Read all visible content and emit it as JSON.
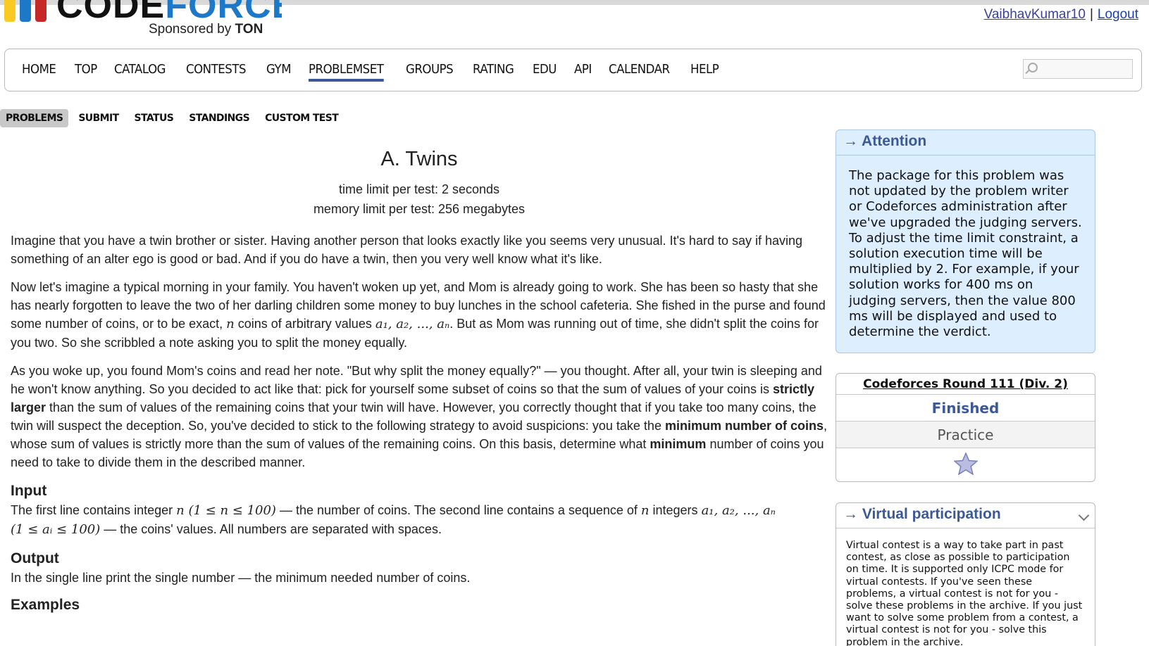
{
  "header": {
    "logo_word_dark": "CODE",
    "logo_word_blue": "FORCES",
    "sponsor_prefix": "Sponsored by",
    "sponsor_name": "TON",
    "user": "VaibhavKumar10",
    "separator": "|",
    "logout": "Logout"
  },
  "menu": {
    "items": [
      "HOME",
      "TOP",
      "CATALOG",
      "CONTESTS",
      "GYM",
      "PROBLEMSET",
      "GROUPS",
      "RATING",
      "EDU",
      "API",
      "CALENDAR",
      "HELP"
    ],
    "active": "PROBLEMSET"
  },
  "submenu": {
    "items": [
      "PROBLEMS",
      "SUBMIT",
      "STATUS",
      "STANDINGS",
      "CUSTOM TEST"
    ],
    "active": "PROBLEMS"
  },
  "problem": {
    "title": "A. Twins",
    "time_limit": "time limit per test: 2 seconds",
    "memory_limit": "memory limit per test: 256 megabytes",
    "p1": "Imagine that you have a twin brother or sister. Having another person that looks exactly like you seems very unusual. It's hard to say if having something of an alter ego is good or bad. And if you do have a twin, then you very well know what it's like.",
    "p2_a": "Now let's imagine a typical morning in your family. You haven't woken up yet, and Mom is already going to work. She has been so hasty that she has nearly forgotten to leave the two of her darling children some money to buy lunches in the school cafeteria. She fished in the purse and found some number of coins, or to be exact, ",
    "p2_n": "n",
    "p2_b": " coins of arbitrary values ",
    "p2_vals": "a₁, a₂, ..., aₙ",
    "p2_c": ". But as Mom was running out of time, she didn't split the coins for you two. So she scribbled a note asking you to split the money equally.",
    "p3_a": "As you woke up, you found Mom's coins and read her note. \"But why split the money equally?\" — you thought. After all, your twin is sleeping and he won't know anything. So you decided to act like that: pick for yourself some subset of coins so that the sum of values of your coins is ",
    "p3_b1": "strictly larger",
    "p3_b": " than the sum of values of the remaining coins that your twin will have. However, you correctly thought that if you take too many coins, the twin will suspect the deception. So, you've decided to stick to the following strategy to avoid suspicions: you take the ",
    "p3_b2": "minimum number of coins",
    "p3_c": ", whose sum of values is strictly more than the sum of values of the remaining coins. On this basis, determine what ",
    "p3_b3": "minimum",
    "p3_d": " number of coins you need to take to divide them in the described manner.",
    "input_title": "Input",
    "input_a": "The first line contains integer ",
    "input_n": "n",
    "input_range": " (1 ≤ n ≤ 100)",
    "input_b": " — the number of coins. The second line contains a sequence of ",
    "input_n2": "n",
    "input_c": " integers ",
    "input_vals": "a₁, a₂, ..., aₙ",
    "input_range2": "(1 ≤ aᵢ ≤ 100)",
    "input_d": " — the coins' values. All numbers are separated with spaces.",
    "output_title": "Output",
    "output_text": "In the single line print the single number — the minimum needed number of coins.",
    "examples_title": "Examples"
  },
  "sidebar": {
    "attention_title": "→ Attention",
    "attention_text": "The package for this problem was not updated by the problem writer or Codeforces administration after we've upgraded the judging servers. To adjust the time limit constraint, a solution execution time will be multiplied by 2. For example, if your solution works for 400 ms on judging servers, then the value 800 ms will be displayed and used to determine the verdict.",
    "round_name": "Codeforces Round 111 (Div. 2)",
    "round_status": "Finished",
    "round_mode": "Practice",
    "virtual_title": "→ Virtual participation",
    "virtual_text": "Virtual contest is a way to take part in past contest, as close as possible to participation on time. It is supported only ICPC mode for virtual contests. If you've seen these problems, a virtual contest is not for you - solve these problems in the archive. If you just want to solve some problem from a contest, a virtual contest is not for you - solve this problem in the archive."
  },
  "colors": {
    "brand_blue": "#1e78c8",
    "link": "#3b5998",
    "attention_bg": "#ddeeff"
  }
}
